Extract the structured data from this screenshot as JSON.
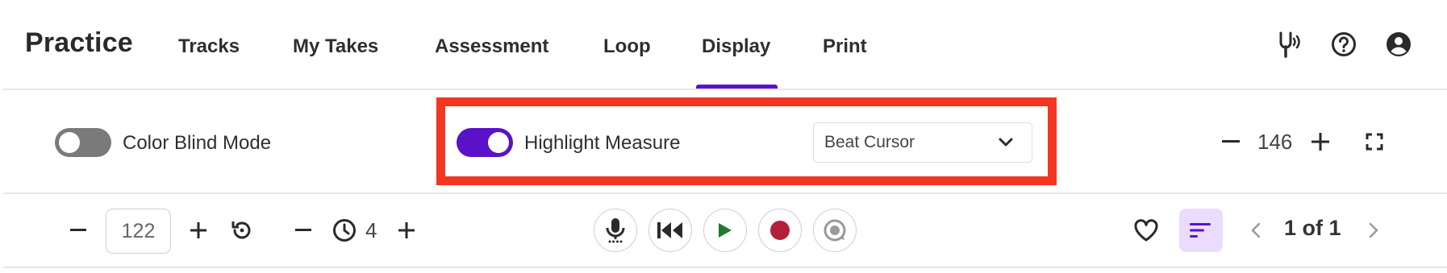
{
  "header": {
    "brand": "Practice",
    "tabs": [
      {
        "label": "Tracks"
      },
      {
        "label": "My Takes"
      },
      {
        "label": "Assessment"
      },
      {
        "label": "Loop"
      },
      {
        "label": "Display",
        "active": true
      },
      {
        "label": "Print"
      }
    ],
    "icons": [
      "tuning-fork-icon",
      "help-icon",
      "account-icon"
    ]
  },
  "display_row": {
    "color_blind_label": "Color Blind Mode",
    "color_blind_on": false,
    "highlight_label": "Highlight Measure",
    "highlight_on": true,
    "cursor_select_value": "Beat Cursor",
    "zoom_value": "146"
  },
  "controls": {
    "tempo_value": "122",
    "count_in_value": "4",
    "pagination": "1 of 1"
  },
  "colors": {
    "accent": "#5a12c8",
    "highlight_border": "#f3361f",
    "play_green": "#1f7a2f",
    "record_red": "#b3203a",
    "filter_bg": "#eadcff"
  }
}
